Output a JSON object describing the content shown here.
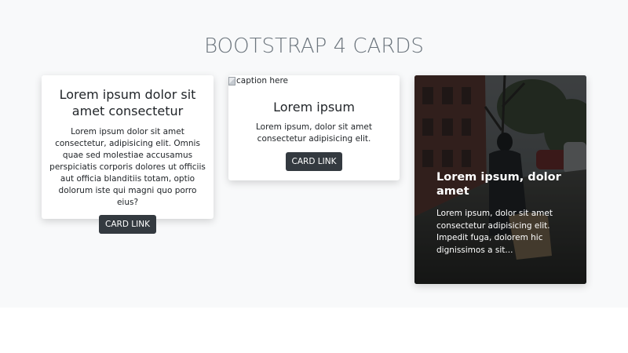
{
  "page": {
    "heading": "BOOTSTRAP 4 CARDS"
  },
  "cards": [
    {
      "title": "Lorem ipsum dolor sit amet consectetur",
      "text": "Lorem ipsum dolor sit amet consectetur, adipisicing elit. Omnis quae sed molestiae accusamus perspiciatis corporis dolores ut officiis aut officia blanditiis totam, optio dolorum iste qui magni quo porro eius?",
      "link_label": "CARD LINK"
    },
    {
      "image_alt": "caption here",
      "title": "Lorem ipsum",
      "text": "Lorem ipsum, dolor sit amet consectetur adipisicing elit.",
      "link_label": "CARD LINK"
    },
    {
      "title": "Lorem ipsum, dolor amet",
      "text": "Lorem ipsum, dolor sit amet consectetur adipisicing elit. Impedit fuga, dolorem hic dignissimos a sit..."
    }
  ],
  "colors": {
    "page_background": "#f8f9fa",
    "heading": "#6c757d",
    "button": "#343a40",
    "card": "#ffffff"
  },
  "icons": {
    "broken_image": "broken-image-icon"
  }
}
